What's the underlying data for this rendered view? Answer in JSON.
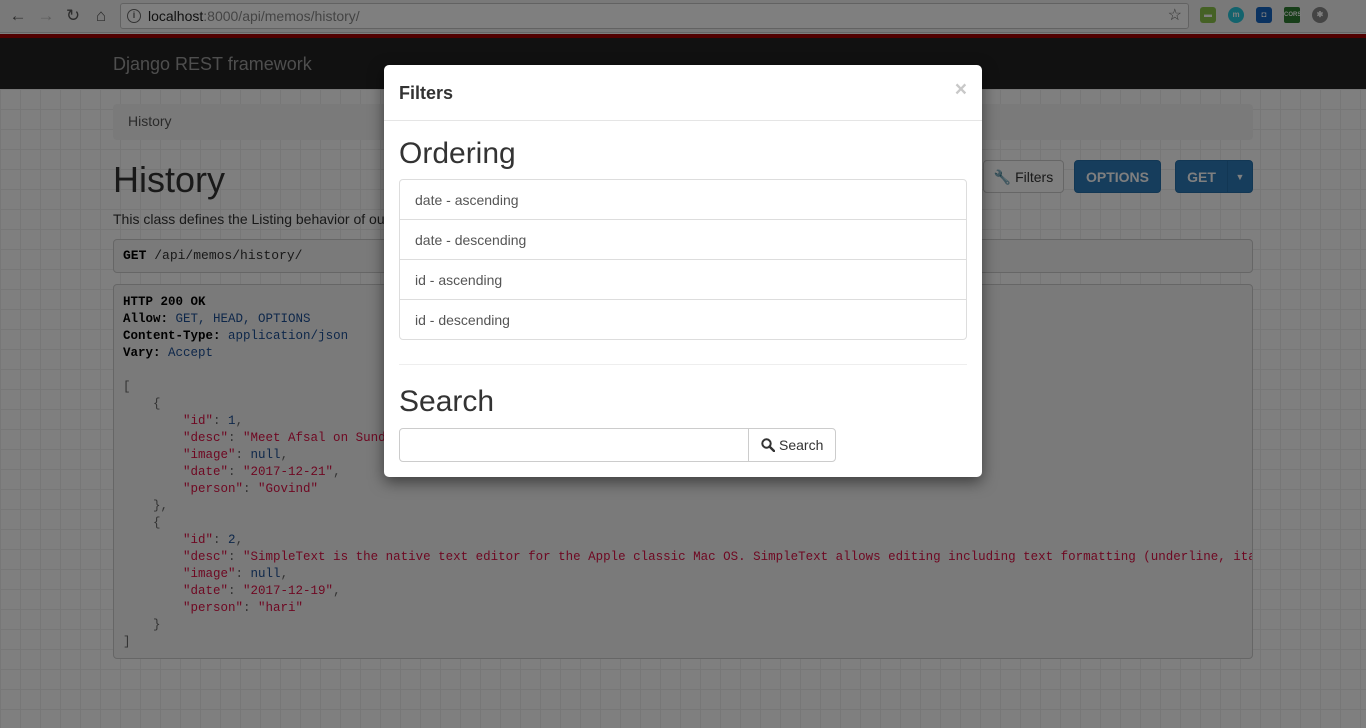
{
  "browser": {
    "url_host": "localhost",
    "url_rest": ":8000/api/memos/history/",
    "extensions": [
      "csv-extension-icon",
      "m-extension-icon",
      "robot-extension-icon",
      "cors-extension-icon",
      "settings-extension-icon"
    ]
  },
  "navbar": {
    "brand": "Django REST framework"
  },
  "breadcrumb": {
    "item": "History"
  },
  "header": {
    "title": "History",
    "description": "This class defines the Listing behavior of ou",
    "buttons": {
      "filters": "Filters",
      "options": "OPTIONS",
      "get": "GET"
    }
  },
  "request": {
    "method": "GET",
    "path": "/api/memos/history/"
  },
  "response": {
    "status": "HTTP 200 OK",
    "allow_label": "Allow:",
    "allow_value": "GET, HEAD, OPTIONS",
    "content_type_label": "Content-Type:",
    "content_type_value": "application/json",
    "vary_label": "Vary:",
    "vary_value": "Accept",
    "items": [
      {
        "id": "1",
        "desc": "\"Meet Afsal on Sunday",
        "image": "null",
        "date": "\"2017-12-21\"",
        "person": "\"Govind\""
      },
      {
        "id": "2",
        "desc": "\"SimpleText is the native text editor for the Apple classic Mac OS. SimpleText allows editing including text formatting (underline, italic, b",
        "image": "null",
        "date": "\"2017-12-19\"",
        "person": "\"hari\""
      }
    ]
  },
  "modal": {
    "title": "Filters",
    "close": "×",
    "ordering_heading": "Ordering",
    "ordering_options": [
      "date - ascending",
      "date - descending",
      "id - ascending",
      "id - descending"
    ],
    "search_heading": "Search",
    "search_value": "",
    "search_button": "Search"
  },
  "colors": {
    "primary": "#2c7ab9",
    "navbar": "#222222",
    "string": "#dd1144",
    "literal": "#1c4f95"
  }
}
